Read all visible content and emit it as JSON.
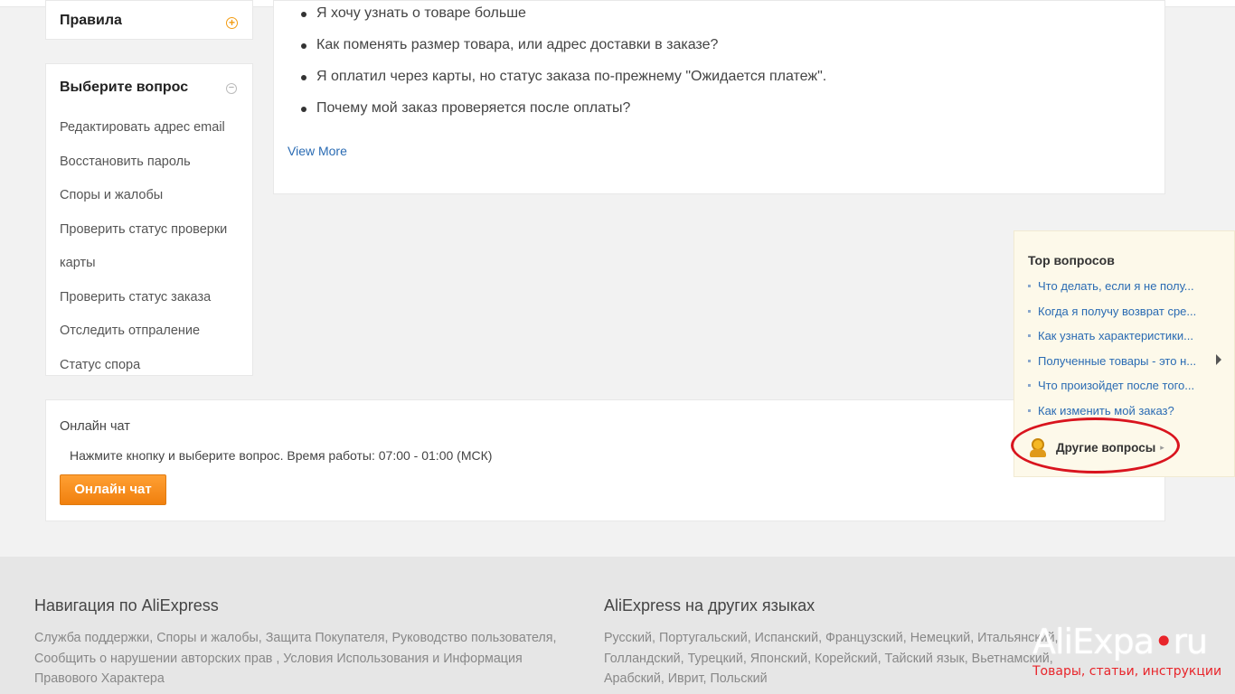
{
  "sidebar": {
    "rules_title": "Правила",
    "questions_title": "Выберите вопрос",
    "items": [
      "Редактировать адрес email",
      "Восстановить пароль",
      "Споры и жалобы",
      "Проверить статус проверки",
      "карты",
      "Проверить статус заказа",
      "Отследить отпраление",
      "Статус спора"
    ]
  },
  "main": {
    "questions": [
      "Я хочу узнать о товаре больше",
      "Как поменять размер товара, или адрес доставки в заказе?",
      "Я оплатил через карты, но статус заказа по-прежнему \"Ожидается платеж\".",
      "Почему мой заказ проверяется после оплаты?"
    ],
    "view_more": "View More"
  },
  "chat": {
    "title": "Онлайн чат",
    "description": "Нажмите кнопку и выберите вопрос. Время работы: 07:00 - 01:00 (МСК)",
    "button_label": "Онлайн чат"
  },
  "top_questions": {
    "title": "Top вопросов",
    "items": [
      "Что делать, если я не полу...",
      "Когда я получу возврат сре...",
      "Как узнать характеристики...",
      "Полученные товары - это н...",
      "Что произойдет после того...",
      "Как изменить мой заказ?"
    ],
    "other_label": "Другие вопросы",
    "other_arrow": "▸"
  },
  "footer": {
    "nav_title": "Навигация по AliExpress",
    "nav_text": "Служба поддержки, Споры и жалобы, Защита Покупателя, Руководство пользователя, Сообщить о нарушении авторских прав , Условия Использования и Информация Правового Характера",
    "lang_title": "AliExpress на других языках",
    "lang_text": "Русский, Португальский, Испанский, Французский, Немецкий, Итальянский, Голландский, Турецкий, Японский, Корейский, Тайский язык, Вьетнамский, Арабский, Иврит, Польский"
  },
  "watermark": {
    "logo_part1": "AliExpa",
    "logo_dot": "•",
    "logo_part2": "ru",
    "subtitle": "Товары, статьи, инструкции"
  },
  "colors": {
    "accent_orange": "#f0800e",
    "link_blue": "#2a6bb3",
    "highlight_red": "#d9141e"
  }
}
